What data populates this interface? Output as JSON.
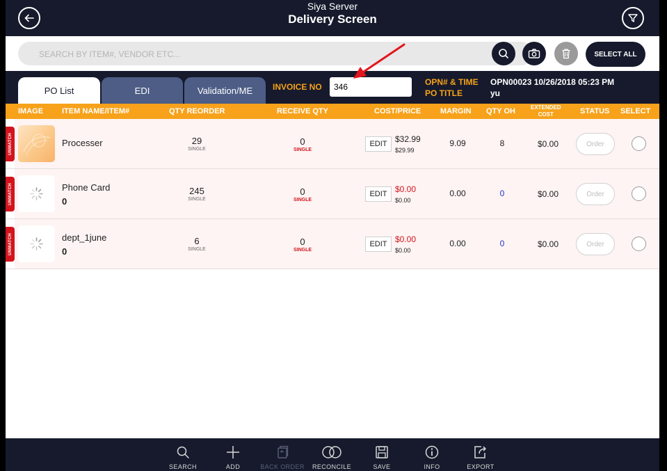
{
  "header": {
    "subtitle": "Siya Server",
    "title": "Delivery Screen",
    "back_icon": "back-arrow-icon",
    "filter_icon": "filter-icon"
  },
  "search": {
    "placeholder": "SEARCH BY ITEM#, VENDOR ETC...",
    "value": "",
    "select_all_label": "SELECT ALL"
  },
  "tabs": [
    {
      "label": "PO List",
      "active": true
    },
    {
      "label": "EDI",
      "active": false
    },
    {
      "label": "Validation/ME",
      "active": false
    }
  ],
  "invoice": {
    "label": "INVOICE NO",
    "value": "346"
  },
  "opn": {
    "label1": "OPN# & TIME",
    "label2": "PO TITLE",
    "value1": "OPN00023  10/26/2018 05:23 PM",
    "value2": "yu"
  },
  "columns": {
    "image": "IMAGE",
    "item_name": "ITEM NAME/ITEM#",
    "qty_reorder": "QTY REORDER",
    "receive_qty": "RECEIVE QTY",
    "cost_price": "COST/PRICE",
    "margin": "MARGIN",
    "qty_oh": "QTY OH",
    "extended_cost_1": "EXTENDED",
    "extended_cost_2": "COST",
    "status": "STATUS",
    "select": "SELECT"
  },
  "rows": [
    {
      "badge": "UNMATCH",
      "name": "Processer",
      "item_no": "",
      "qty_reorder": "29",
      "qty_unit": "SINGLE",
      "receive_qty": "0",
      "receive_unit": "SINGLE",
      "edit_label": "EDIT",
      "price": "$32.99",
      "cost": "$29.99",
      "margin": "9.09",
      "qty_oh": "8",
      "extended_cost": "$0.00",
      "status": "Order"
    },
    {
      "badge": "UNMATCH",
      "name": "Phone Card",
      "item_no": "0",
      "qty_reorder": "245",
      "qty_unit": "SINGLE",
      "receive_qty": "0",
      "receive_unit": "SINGLE",
      "edit_label": "EDIT",
      "price": "$0.00",
      "cost": "$0.00",
      "margin": "0.00",
      "qty_oh": "0",
      "extended_cost": "$0.00",
      "status": "Order"
    },
    {
      "badge": "UNMATCH",
      "name": "dept_1june",
      "item_no": "0",
      "qty_reorder": "6",
      "qty_unit": "SINGLE",
      "receive_qty": "0",
      "receive_unit": "SINGLE",
      "edit_label": "EDIT",
      "price": "$0.00",
      "cost": "$0.00",
      "margin": "0.00",
      "qty_oh": "0",
      "extended_cost": "$0.00",
      "status": "Order"
    }
  ],
  "toolbar": [
    {
      "label": "SEARCH",
      "icon": "search-icon",
      "enabled": true
    },
    {
      "label": "ADD",
      "icon": "plus-icon",
      "enabled": true
    },
    {
      "label": "BACK ORDER",
      "icon": "back-order-icon",
      "enabled": false
    },
    {
      "label": "RECONCILE",
      "icon": "reconcile-icon",
      "enabled": true
    },
    {
      "label": "SAVE",
      "icon": "save-icon",
      "enabled": true
    },
    {
      "label": "INFO",
      "icon": "info-icon",
      "enabled": true
    },
    {
      "label": "EXPORT",
      "icon": "export-icon",
      "enabled": true
    }
  ],
  "colors": {
    "navy": "#161a2c",
    "orange": "#f7a21a",
    "badge_red": "#d3141d",
    "tab_inactive": "#4d5d86",
    "row_bg": "#fdf4f3",
    "qty_blue": "#2233cc"
  }
}
